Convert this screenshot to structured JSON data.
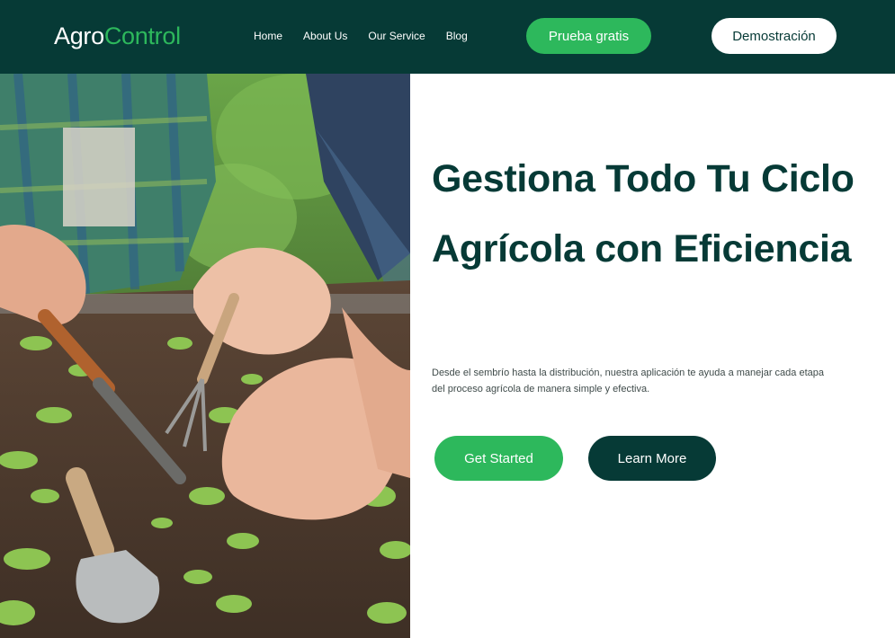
{
  "brand": {
    "logo_part1": "Agro",
    "logo_part2": "Control",
    "colors": {
      "dark": "#063a36",
      "accent": "#2db85c",
      "white": "#ffffff"
    }
  },
  "nav": {
    "links": [
      "Home",
      "About Us",
      "Our Service",
      "Blog"
    ],
    "trial_label": "Prueba gratis",
    "demo_label": "Demostración"
  },
  "hero": {
    "image": "gardening-hands-planting-seedlings",
    "title": "Gestiona Todo Tu Ciclo Agrícola con Eficiencia",
    "description": "Desde el sembrío hasta la distribución, nuestra aplicación te ayuda a manejar cada etapa del proceso agrícola de manera simple y efectiva.",
    "get_started_label": "Get Started",
    "learn_more_label": "Learn More"
  }
}
